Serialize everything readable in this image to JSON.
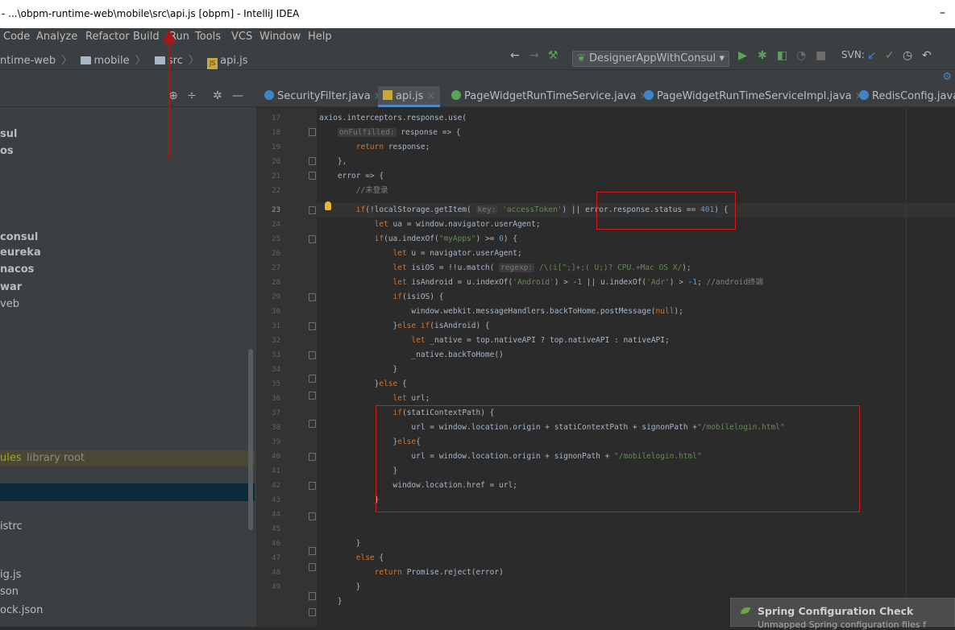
{
  "window": {
    "title": "- ...\\obpm-runtime-web\\mobile\\src\\api.js [obpm] - IntelliJ IDEA",
    "minimize": "–"
  },
  "menu": [
    "Code",
    "Analyze",
    "Refactor",
    "Build",
    "Run",
    "Tools",
    "VCS",
    "Window",
    "Help"
  ],
  "breadcrumb": {
    "project": "ntime-web",
    "folder1": "mobile",
    "folder2": "src",
    "file": "api.js"
  },
  "toolbar": {
    "run_config": "DesignerAppWithConsul",
    "svn_label": "SVN:"
  },
  "sidebar": {
    "items": [
      {
        "label": "sul",
        "bold": true
      },
      {
        "label": "os",
        "bold": true
      },
      {
        "label": "consul",
        "bold": true
      },
      {
        "label": "eureka",
        "bold": true
      },
      {
        "label": "nacos",
        "bold": true
      },
      {
        "label": "war",
        "bold": true
      },
      {
        "label": "veb",
        "bold": false
      },
      {
        "label": "ules",
        "suffix": "library root"
      },
      {
        "label": "istrc"
      },
      {
        "label": "ig.js"
      },
      {
        "label": "son"
      },
      {
        "label": "ock.json"
      }
    ]
  },
  "tabs": [
    {
      "label": "SecurityFilter.java",
      "icon": "class-icon"
    },
    {
      "label": "api.js",
      "icon": "js-file-icon",
      "active": true
    },
    {
      "label": "PageWidgetRunTimeService.java",
      "icon": "interface-icon"
    },
    {
      "label": "PageWidgetRunTimeServiceImpl.java",
      "icon": "class-icon"
    },
    {
      "label": "RedisConfig.java",
      "icon": "class-icon"
    }
  ],
  "editor": {
    "line_numbers": [
      "17",
      "18",
      "19",
      "20",
      "21",
      "22",
      "23",
      "24",
      "25",
      "26",
      "27",
      "28",
      "29",
      "30",
      "31",
      "32",
      "33",
      "34",
      "35",
      "36",
      "37",
      "38",
      "39",
      "40",
      "41",
      "42",
      "43",
      "44",
      "45",
      "46",
      "47",
      "48",
      "49"
    ],
    "current_line": "23"
  },
  "notification": {
    "title": "Spring Configuration Check",
    "body": "Unmapped Spring configuration files f"
  }
}
